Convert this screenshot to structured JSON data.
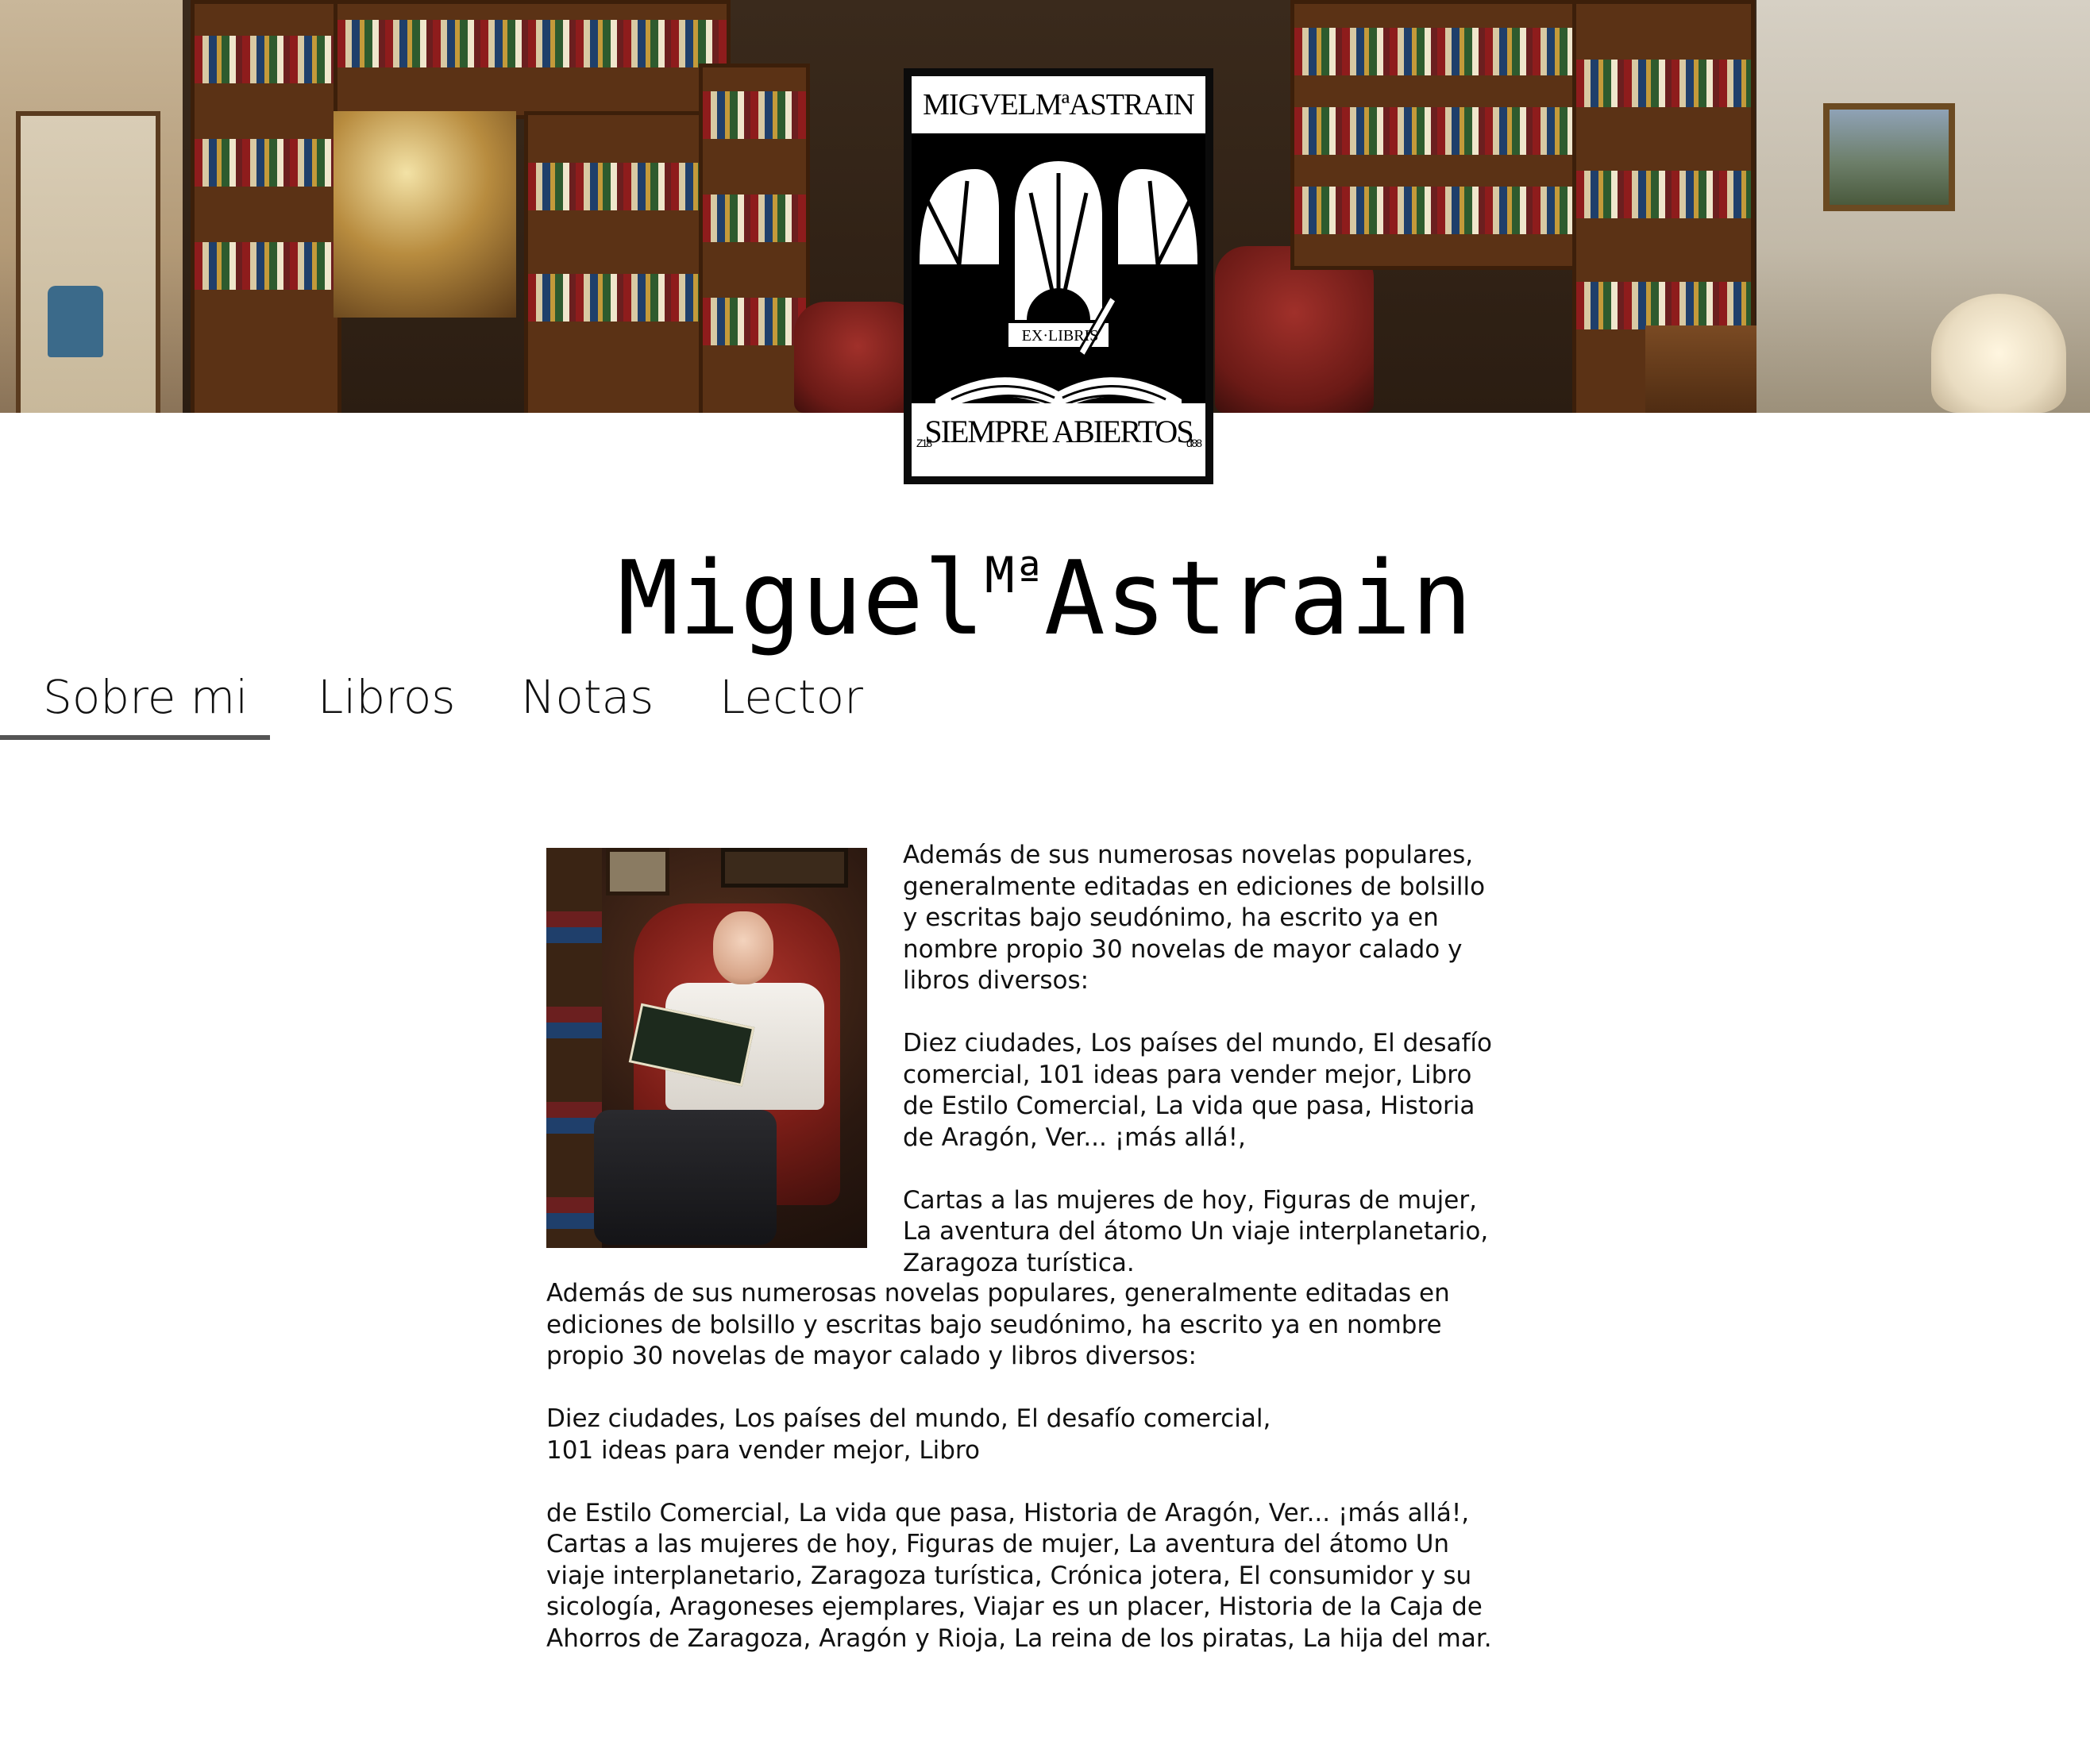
{
  "logo": {
    "top_text": "MIGVELMªASTRAIN",
    "center_text": "EX·LIBRIS",
    "bottom_text": "SIEMPRE ABIERTOS",
    "corner_left": "Z18",
    "corner_right": "d'88"
  },
  "site_title": {
    "first": "Miguel",
    "superscript": "Mª",
    "last": "Astrain"
  },
  "nav": {
    "items": [
      {
        "label": "Sobre mi",
        "active": true
      },
      {
        "label": "Libros",
        "active": false
      },
      {
        "label": "Notas",
        "active": false
      },
      {
        "label": "Lector",
        "active": false
      }
    ]
  },
  "content": {
    "side_paragraphs": [
      "Además de sus numerosas novelas populares,\ngeneralmente editadas en ediciones de bolsillo\ny escritas bajo seudónimo, ha escrito ya en\nnombre propio 30 novelas de mayor calado y\nlibros diversos:",
      "Diez ciudades, Los países del mundo, El desafío\ncomercial, 101 ideas para vender mejor, Libro\nde Estilo Comercial, La vida que pasa, Historia\nde Aragón, Ver... ¡más allá!,",
      "Cartas a las mujeres de hoy, Figuras de mujer,\n La aventura del átomo Un viaje interplanetario,\nZaragoza turística."
    ],
    "full_paragraphs": [
      "Además de sus numerosas novelas populares, generalmente editadas en\nediciones de bolsillo y escritas bajo seudónimo, ha escrito ya en nombre\npropio 30 novelas de mayor calado y libros diversos:",
      "Diez ciudades, Los países del mundo, El desafío comercial,\n101 ideas para vender mejor, Libro",
      "de Estilo Comercial, La vida que pasa, Historia de Aragón, Ver... ¡más allá!,\nCartas a las mujeres de hoy, Figuras de mujer, La aventura del átomo Un\nviaje interplanetario, Zaragoza turística, Crónica jotera, El consumidor y su\nsicología, Aragoneses ejemplares, Viajar es un placer, Historia de la Caja de\nAhorros de Zaragoza, Aragón y Rioja, La reina de los piratas, La hija del mar."
    ]
  },
  "colors": {
    "background": "#ffffff",
    "text": "#111111",
    "nav_underline": "#555555",
    "logo_black": "#0b0b0b"
  }
}
